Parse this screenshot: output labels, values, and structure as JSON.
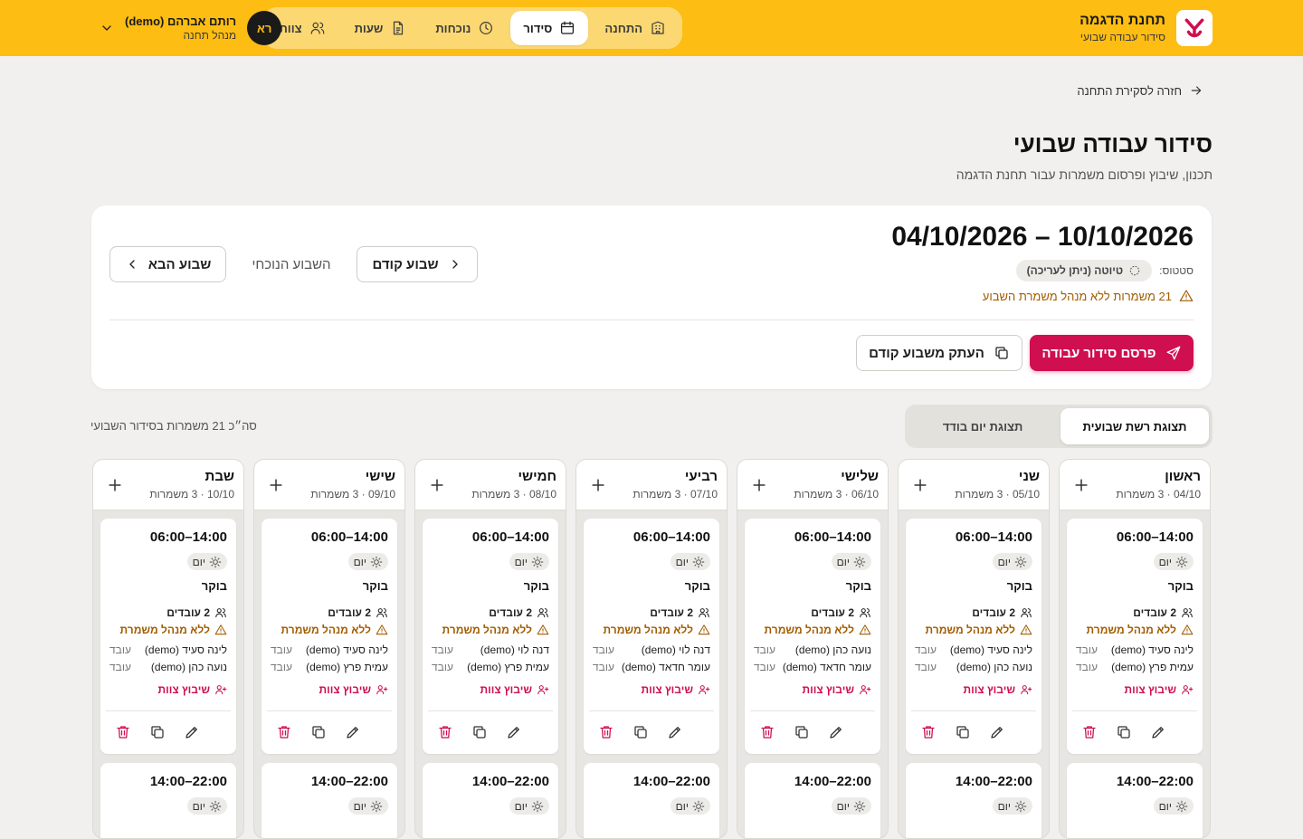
{
  "header": {
    "brand_name": "תחנת הדגמה",
    "brand_sub": "סידור עבודה שבועי",
    "nav": [
      {
        "label": "התחנה",
        "icon": "building-icon"
      },
      {
        "label": "סידור",
        "icon": "calendar-icon"
      },
      {
        "label": "נוכחות",
        "icon": "clock-icon"
      },
      {
        "label": "שעות",
        "icon": "document-icon"
      },
      {
        "label": "צוות",
        "icon": "users-icon"
      }
    ],
    "user_initials": "רא",
    "user_name": "רותם אברהם (demo)",
    "user_role": "מנהל תחנה"
  },
  "back_link": "חזרה לסקירת התחנה",
  "page_title": "סידור עבודה שבועי",
  "page_subtitle": "תכנון, שיבוץ ופרסום משמרות עבור תחנת הדגמה",
  "week": {
    "range": "04/10/2026 – 10/10/2026",
    "status_label": "סטטוס:",
    "status_value": "טיוטה (ניתן לעריכה)",
    "warning": "21 משמרות ללא מנהל משמרת השבוע",
    "next_label": "שבוע הבא",
    "current_label": "השבוע הנוכחי",
    "prev_label": "שבוע קודם",
    "copy_label": "העתק משבוע קודם",
    "publish_label": "פרסם סידור עבודה"
  },
  "view_tabs": [
    "תצוגת רשת שבועית",
    "תצוגת יום בודד"
  ],
  "total_text": "סה״כ 21 משמרות בסידור השבועי",
  "days": [
    {
      "name": "ראשון",
      "date": "04/10",
      "shifts": "3 משמרות",
      "emp1": "לינה סעיד (demo)",
      "emp2": "עמית פרץ (demo)"
    },
    {
      "name": "שני",
      "date": "05/10",
      "shifts": "3 משמרות",
      "emp1": "לינה סעיד (demo)",
      "emp2": "נועה כהן (demo)"
    },
    {
      "name": "שלישי",
      "date": "06/10",
      "shifts": "3 משמרות",
      "emp1": "נועה כהן (demo)",
      "emp2": "עומר חדאד (demo)"
    },
    {
      "name": "רביעי",
      "date": "07/10",
      "shifts": "3 משמרות",
      "emp1": "דנה לוי (demo)",
      "emp2": "עומר חדאד (demo)"
    },
    {
      "name": "חמישי",
      "date": "08/10",
      "shifts": "3 משמרות",
      "emp1": "דנה לוי (demo)",
      "emp2": "עמית פרץ (demo)"
    },
    {
      "name": "שישי",
      "date": "09/10",
      "shifts": "3 משמרות",
      "emp1": "לינה סעיד (demo)",
      "emp2": "עמית פרץ (demo)"
    },
    {
      "name": "שבת",
      "date": "10/10",
      "shifts": "3 משמרות",
      "emp1": "לינה סעיד (demo)",
      "emp2": "נועה כהן (demo)"
    }
  ],
  "shift_card": {
    "time": "06:00–14:00",
    "type": "יום",
    "name": "בוקר",
    "count": "2 עובדים",
    "no_manager": "ללא מנהל משמרת",
    "role": "עובד",
    "assign": "שיבוץ צוות"
  },
  "shift_card_2": {
    "time": "14:00–22:00",
    "type": "יום"
  },
  "colors": {
    "brand_yellow": "#fdbd12",
    "primary": "#cf0f4f",
    "warning": "#a15c00"
  }
}
